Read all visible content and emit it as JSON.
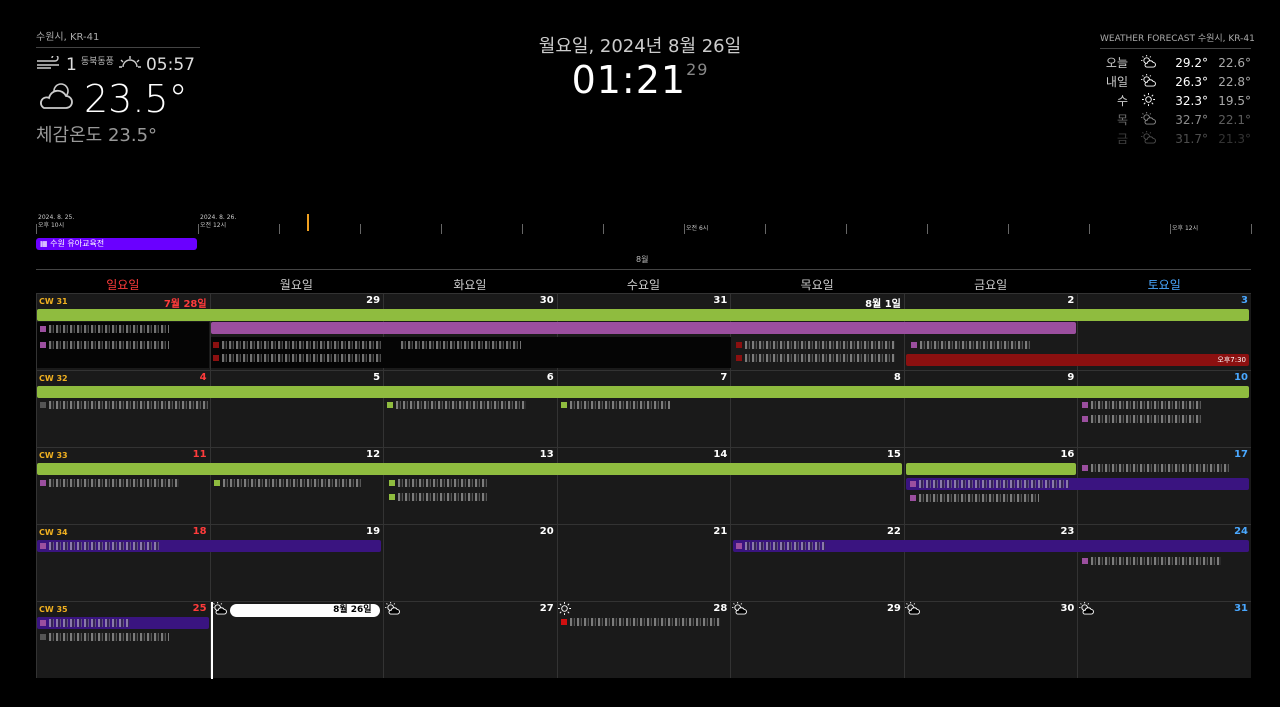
{
  "current_weather": {
    "location": "수원시, KR-41",
    "wind_speed": "1",
    "wind_dir": "동북동풍",
    "sunset": "05:57",
    "temperature": "23.5°",
    "feels_like": "체감온도 23.5°",
    "wind_icon": "wind-icon",
    "sun_icon": "sunrise-icon",
    "weather_icon": "partly-cloudy-icon"
  },
  "clock": {
    "date": "월요일, 2024년 8월 26일",
    "time": "01:21",
    "seconds": "29"
  },
  "forecast": {
    "header": "WEATHER FORECAST 수원시, KR-41",
    "days": [
      {
        "day": "오늘",
        "icon": "sun-cloud-icon",
        "max": "29.2°",
        "min": "22.6°"
      },
      {
        "day": "내일",
        "icon": "sun-cloud-icon",
        "max": "26.3°",
        "min": "22.8°"
      },
      {
        "day": "수",
        "icon": "sun-icon",
        "max": "32.3°",
        "min": "19.5°"
      },
      {
        "day": "목",
        "icon": "sun-cloud-icon",
        "max": "32.7°",
        "min": "22.1°"
      },
      {
        "day": "금",
        "icon": "sun-cloud-icon",
        "max": "31.7°",
        "min": "21.3°"
      }
    ]
  },
  "timeline": {
    "labels": [
      {
        "text": "2024. 8. 25.\n오후 10시"
      },
      {
        "text": "2024. 8. 26.\n오전 12시"
      },
      {
        "text": "오전 6시"
      },
      {
        "text": "오후 12시"
      }
    ],
    "event": "수원 유아교육전",
    "month": "8월"
  },
  "calendar": {
    "weekdays": [
      "일요일",
      "월요일",
      "화요일",
      "수요일",
      "목요일",
      "금요일",
      "토요일"
    ],
    "weekday_colors": [
      "#ff3b3b",
      "#cccccc",
      "#cccccc",
      "#cccccc",
      "#cccccc",
      "#cccccc",
      "#4aa8ff"
    ],
    "weeks": [
      {
        "cw": "CW 31",
        "days": [
          "7월 28일",
          "29",
          "30",
          "31",
          "8월 1일",
          "2",
          "3"
        ]
      },
      {
        "cw": "CW 32",
        "days": [
          "4",
          "5",
          "6",
          "7",
          "8",
          "9",
          "10"
        ]
      },
      {
        "cw": "CW 33",
        "days": [
          "11",
          "12",
          "13",
          "14",
          "15",
          "16",
          "17"
        ]
      },
      {
        "cw": "CW 34",
        "days": [
          "18",
          "19",
          "20",
          "21",
          "22",
          "23",
          "24"
        ]
      },
      {
        "cw": "CW 35",
        "days": [
          "25",
          "8월 26일",
          "27",
          "28",
          "29",
          "30",
          "31"
        ]
      }
    ],
    "event_time": "오후7:30",
    "colors": {
      "green": "#8fbc3f",
      "purple": "#9b4f9f",
      "darkred": "#8b1010",
      "indigo": "#3a1480",
      "sunday": "#ff3b3b",
      "saturday": "#4aa8ff"
    }
  }
}
